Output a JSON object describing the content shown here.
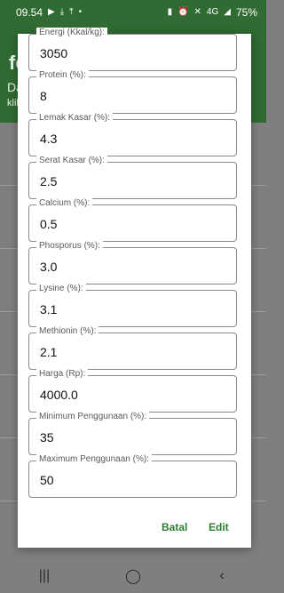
{
  "status_bar": {
    "time": "09.54",
    "battery": "75%",
    "network": "4G",
    "icons": [
      "youtube-icon",
      "download-icon",
      "upload-icon",
      "dot-icon",
      "battery-saver-icon",
      "alarm-icon",
      "silent-icon",
      "signal-icon",
      "battery-icon"
    ]
  },
  "app": {
    "title": "fe",
    "subtitle1": "Da",
    "subtitle2": "klik"
  },
  "dialog": {
    "fields": [
      {
        "label": "Energi (Kkal/kg):",
        "value": "3050"
      },
      {
        "label": "Protein (%):",
        "value": "8"
      },
      {
        "label": "Lemak Kasar (%):",
        "value": "4.3"
      },
      {
        "label": "Serat Kasar (%):",
        "value": "2.5"
      },
      {
        "label": "Calcium (%):",
        "value": "0.5"
      },
      {
        "label": "Phosporus (%):",
        "value": "3.0"
      },
      {
        "label": "Lysine (%):",
        "value": "3.1"
      },
      {
        "label": "Methionin (%):",
        "value": "2.1"
      },
      {
        "label": "Harga (Rp):",
        "value": "4000.0"
      },
      {
        "label": "Minimum Penggunaan (%):",
        "value": "35"
      },
      {
        "label": "Maximum Penggunaan (%):",
        "value": "50"
      }
    ],
    "actions": {
      "cancel": "Batal",
      "edit": "Edit"
    }
  },
  "navbar": {
    "recent": "|||",
    "home": "◯",
    "back": "‹"
  },
  "colors": {
    "accent": "#2e7d32",
    "header": "#2f6b32",
    "scrim": "#7f7f7f"
  }
}
